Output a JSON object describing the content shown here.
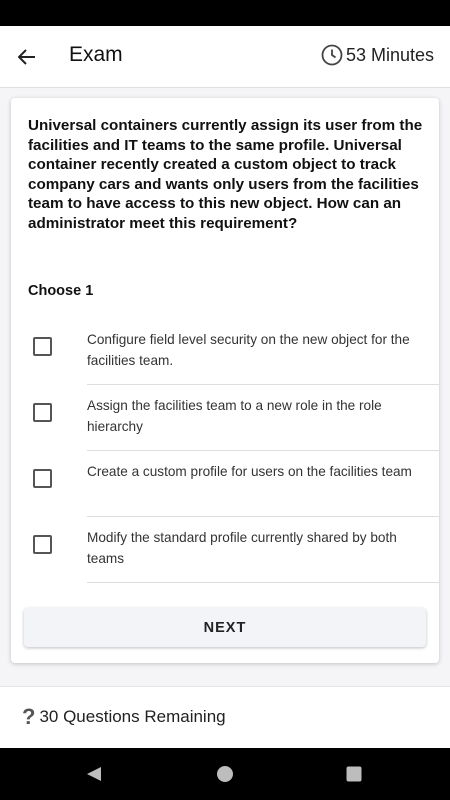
{
  "header": {
    "title": "Exam",
    "timer_label": "53 Minutes"
  },
  "question": {
    "text": "Universal containers currently assign its user from the facilities and IT teams to the same profile. Universal container recently created a custom object to track company cars and wants only users from the facilities team to have access to this new object. How can an administrator meet this requirement?",
    "choose_label": "Choose 1",
    "options": [
      "Configure field level security on the new object for the facilities team.",
      "Assign the facilities team to a new role in the role hierarchy",
      "Create a custom profile for users on the facilities team",
      "Modify the standard profile currently shared by both teams"
    ]
  },
  "actions": {
    "next_label": "NEXT"
  },
  "footer": {
    "remaining_label": "30 Questions Remaining"
  },
  "icons": {
    "back": "arrow-left-icon",
    "timer": "clock-icon",
    "help": "question-mark-icon",
    "nav_back": "triangle-back-icon",
    "nav_home": "circle-home-icon",
    "nav_recents": "square-recents-icon"
  }
}
